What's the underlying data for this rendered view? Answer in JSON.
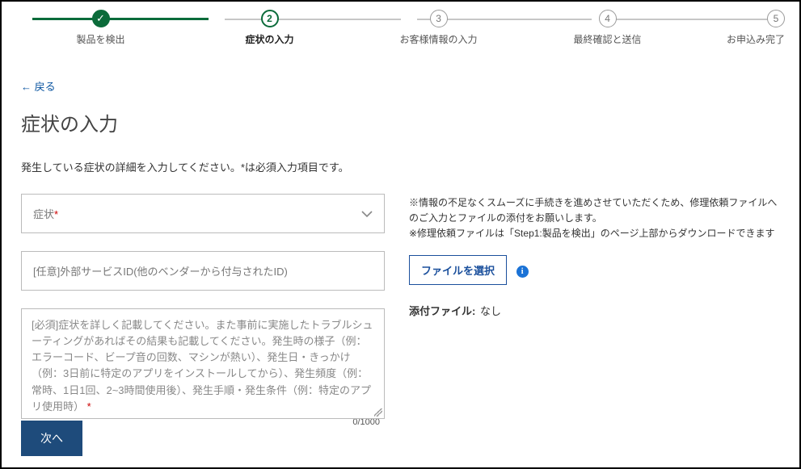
{
  "stepper": {
    "steps": [
      {
        "num": "✓",
        "label": "製品を検出",
        "state": "done"
      },
      {
        "num": "2",
        "label": "症状の入力",
        "state": "active"
      },
      {
        "num": "3",
        "label": "お客様情報の入力",
        "state": "pending"
      },
      {
        "num": "4",
        "label": "最終確認と送信",
        "state": "pending"
      },
      {
        "num": "5",
        "label": "お申込み完了",
        "state": "pending"
      }
    ]
  },
  "back_link": "← 戻る",
  "page_title": "症状の入力",
  "instruction": "発生している症状の詳細を入力してください。*は必須入力項目です。",
  "form": {
    "symptom_select": {
      "label": "症状",
      "required": "*"
    },
    "external_id": {
      "placeholder": "[任意]外部サービスID(他のベンダーから付与されたID)"
    },
    "details": {
      "placeholder": "[必須]症状を詳しく記載してください。また事前に実施したトラブルシューティングがあればその結果も記載してください。発生時の様子（例：エラーコード、ビープ音の回数、マシンが熱い）、発生日・きっかけ（例：3日前に特定のアプリをインストールしてから）、発生頻度（例：常時、1日1回、2~3時間使用後）、発生手順・発生条件（例：特定のアプリ使用時）",
      "required": " *",
      "counter": "0/1000"
    }
  },
  "right": {
    "note_line1": "※情報の不足なくスムーズに手続きを進めさせていただくため、修理依頼ファイルへのご入力とファイルの添付をお願いします。",
    "note_line2": "※修理依頼ファイルは「Step1:製品を検出」のページ上部からダウンロードできます",
    "file_button": "ファイルを選択",
    "attach_label": "添付ファイル:",
    "attach_value": " なし"
  },
  "next_button": "次へ"
}
